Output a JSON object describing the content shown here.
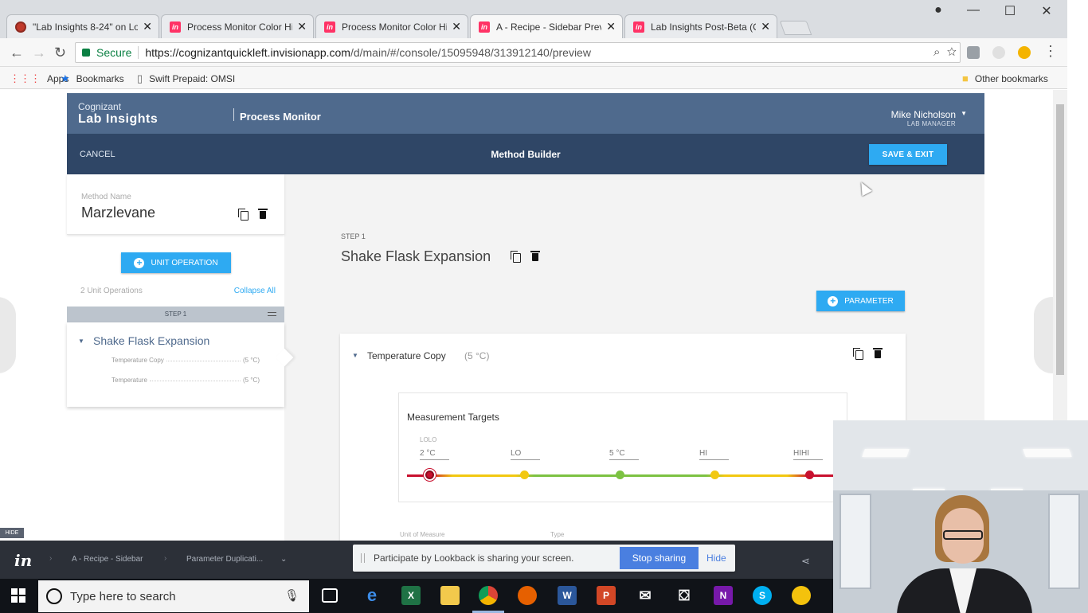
{
  "browser": {
    "tabs": [
      {
        "title": "\"Lab Insights 8-24\" on Lo",
        "icon": "record-icon"
      },
      {
        "title": "Process Monitor Color Hi",
        "icon": "invision-icon"
      },
      {
        "title": "Process Monitor Color Hi",
        "icon": "invision-icon"
      },
      {
        "title": "A - Recipe - Sidebar Prev",
        "icon": "invision-icon"
      },
      {
        "title": "Lab Insights Post-Beta (C",
        "icon": "invision-icon"
      }
    ],
    "secure_label": "Secure",
    "url_host": "https://cognizantquickleft.invisionapp.com",
    "url_path": "/d/main/#/console/15095948/313912140/preview",
    "bookmarks": {
      "apps": "Apps",
      "bookmarks": "Bookmarks",
      "swift": "Swift Prepaid: OMSI",
      "other": "Other bookmarks"
    }
  },
  "app": {
    "brand_small": "Cognizant",
    "brand_big": "Lab Insights",
    "app_name": "Process Monitor",
    "user_name": "Mike Nicholson",
    "user_role": "LAB MANAGER",
    "cancel": "CANCEL",
    "subtitle": "Method Builder",
    "save_exit": "SAVE & EXIT"
  },
  "left": {
    "method_name_label": "Method Name",
    "method_name": "Marzlevane",
    "unit_operation_btn": "UNIT OPERATION",
    "unit_count": "2 Unit Operations",
    "collapse_all": "Collapse All",
    "step_label": "STEP 1",
    "step_name": "Shake Flask Expansion",
    "params": [
      {
        "name": "Temperature Copy",
        "value": "(5 °C)"
      },
      {
        "name": "Temperature",
        "value": "(5 °C)"
      }
    ]
  },
  "main": {
    "step_label": "STEP 1",
    "step_title": "Shake Flask Expansion",
    "parameter_btn": "PARAMETER",
    "param_name": "Temperature Copy",
    "param_value": "(5 °C)",
    "targets_title": "Measurement Targets",
    "lolo_small": "LOLO",
    "targets": [
      {
        "label": "2 °C",
        "color": "#c8102e"
      },
      {
        "label": "LO",
        "color": "#f2c811"
      },
      {
        "label": "5 °C",
        "color": "#7cc242"
      },
      {
        "label": "HI",
        "color": "#f2c811"
      },
      {
        "label": "HIHI",
        "color": "#c8102e"
      }
    ],
    "under_labels": [
      "Unit of Measure",
      "Type"
    ]
  },
  "invision": {
    "hide": "HIDE",
    "crumb1": "A - Recipe - Sidebar",
    "crumb2": "Parameter Duplicati...",
    "share_msg": "Participate by Lookback is sharing your screen.",
    "stop_sharing": "Stop sharing",
    "hide_btn": "Hide"
  },
  "taskbar": {
    "search_placeholder": "Type here to search"
  },
  "colors": {
    "header": "#4f6a8d",
    "subbar": "#2f4666",
    "accent": "#2eaaf2"
  }
}
